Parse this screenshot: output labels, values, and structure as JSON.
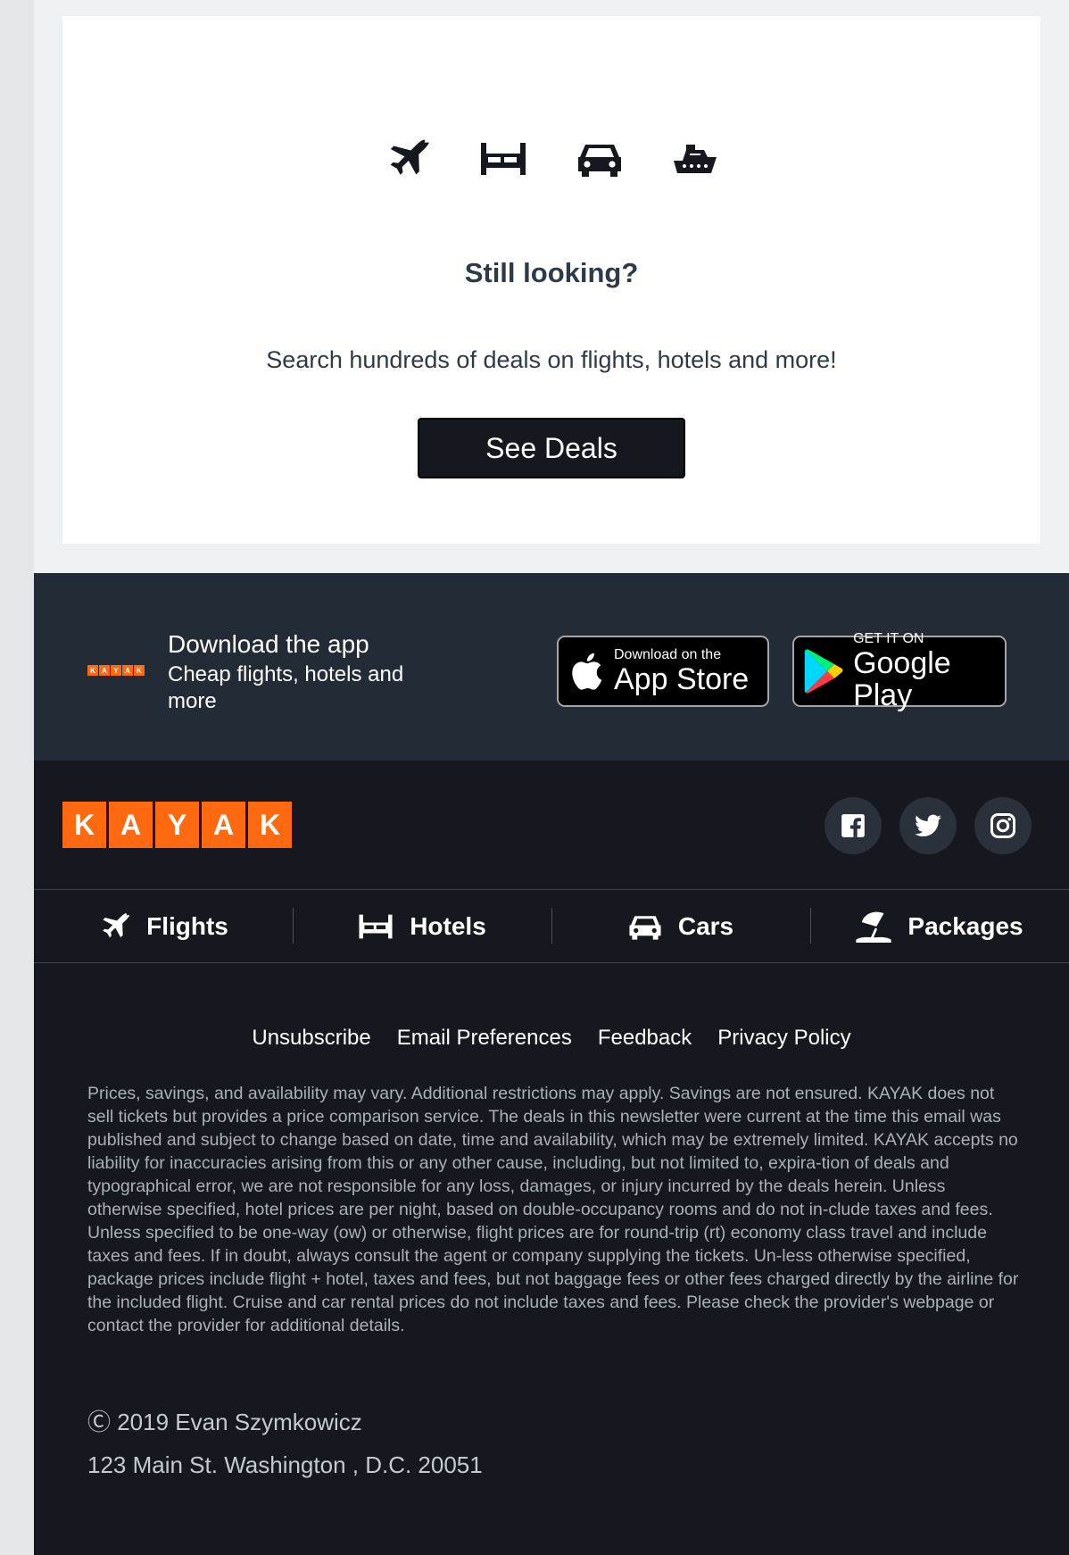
{
  "card": {
    "icons": [
      "airplane-icon",
      "bed-icon",
      "car-icon",
      "cruise-ship-icon"
    ],
    "title": "Still looking?",
    "subtitle": "Search hundreds of deals on flights, hotels and more!",
    "button": "See Deals"
  },
  "app": {
    "mini_logo": [
      "K",
      "A",
      "Y",
      "A",
      "K"
    ],
    "title": "Download the app",
    "subtitle": "Cheap flights, hotels and more",
    "appstore_small": "Download on the",
    "appstore_big": "App Store",
    "googleplay_small": "GET IT ON",
    "googleplay_big": "Google Play"
  },
  "footer": {
    "logo_letters": [
      "K",
      "A",
      "Y",
      "A",
      "K"
    ],
    "social": [
      "facebook-icon",
      "twitter-icon",
      "instagram-icon"
    ],
    "nav": [
      {
        "label": "Flights",
        "icon": "airplane-icon"
      },
      {
        "label": "Hotels",
        "icon": "bed-icon"
      },
      {
        "label": "Cars",
        "icon": "car-icon"
      },
      {
        "label": "Packages",
        "icon": "beach-umbrella-icon"
      }
    ],
    "links": [
      "Unsubscribe",
      "Email Preferences",
      "Feedback",
      "Privacy Policy"
    ],
    "disclaimer": "Prices, savings, and availability may vary. Additional restrictions may apply. Savings are not ensured. KAYAK does not sell tickets but provides a price comparison service. The deals in this newsletter were current at the time this email was published and subject to change based on date, time and availability, which may be extremely limited. KAYAK accepts no liability for inaccuracies arising from this or any other cause, including, but not limited to, expira-tion of deals and typographical error, we are not responsible for any loss, damages, or injury incurred by the deals herein. Unless otherwise specified, hotel prices are per night, based on double-occupancy rooms and do not in-clude taxes and fees. Unless specified to be one-way (ow) or otherwise, flight prices are for round-trip (rt) economy class travel and include taxes and fees. If in doubt, always consult the agent or company supplying the tickets. Un-less otherwise specified, package prices include flight + hotel, taxes and fees, but not baggage fees or other fees charged directly by the airline for the included flight. Cruise and car rental prices do not include taxes and fees. Please check the provider's webpage or contact the provider for additional details.",
    "copyright": "Ⓒ 2019 Evan Szymkowicz",
    "address": "123 Main St. Washington , D.C. 20051"
  },
  "colors": {
    "brand_orange": "#ff690f",
    "footer_bg": "#15191f",
    "app_bg": "#232b36"
  }
}
